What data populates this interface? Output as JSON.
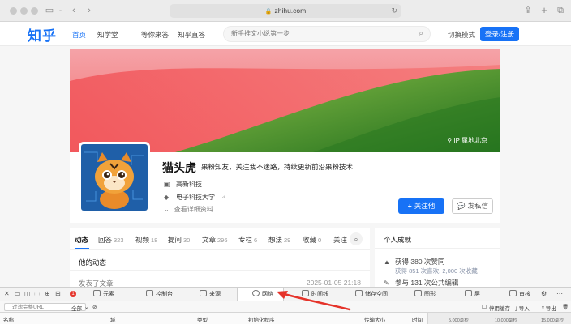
{
  "browser": {
    "address": "zhihu.com"
  },
  "header": {
    "logo": "知乎",
    "nav": [
      "首页",
      "知学堂",
      "等你来答",
      "知乎直答"
    ],
    "search_placeholder": "新手推文小说第一步",
    "mode_toggle": "切换模式",
    "login": "登录/注册"
  },
  "profile": {
    "location": "IP 属地北京",
    "name": "猫头虎",
    "headline": "果粉知友，关注我不迷路，持续更新前沿果粉技术",
    "company": "高新科技",
    "school": "电子科技大学",
    "gender_icon": "male-icon",
    "more": "查看详细资料",
    "follow": "关注他",
    "message": "发私信"
  },
  "feed": {
    "tabs": [
      {
        "label": "动态",
        "count": ""
      },
      {
        "label": "回答",
        "count": "323"
      },
      {
        "label": "视频",
        "count": "18"
      },
      {
        "label": "提问",
        "count": "30"
      },
      {
        "label": "文章",
        "count": "296"
      },
      {
        "label": "专栏",
        "count": "6"
      },
      {
        "label": "想法",
        "count": "29"
      },
      {
        "label": "收藏",
        "count": "0"
      },
      {
        "label": "关注",
        "count": ""
      }
    ],
    "title": "他的动态",
    "item_text": "发表了文章",
    "item_time": "2025-01-05 21:18"
  },
  "achievements": {
    "title": "个人成就",
    "likes": "获得 380 次赞同",
    "likes_sub": "获得 851 次喜欢, 2,000 次收藏",
    "edits": "参与 131 次公共编辑"
  },
  "devtools": {
    "badge": "1",
    "tabs": [
      "元素",
      "控制台",
      "来源",
      "网络",
      "时间线",
      "储存空间",
      "图形",
      "层",
      "审核"
    ],
    "active_tab": "网络",
    "filter_placeholder": "过滤完整URL",
    "all_label": "全部",
    "preserve_log": "停用缓存",
    "import": "导入",
    "export": "导出",
    "columns": [
      "名称",
      "域",
      "类型",
      "初始化程序",
      "传输大小",
      "时间"
    ],
    "timeline_ticks": [
      "5.000毫秒",
      "10.000毫秒",
      "15.000毫秒"
    ]
  },
  "colors": {
    "brand": "#1772f6",
    "annotation_arrow": "#e5332a"
  }
}
